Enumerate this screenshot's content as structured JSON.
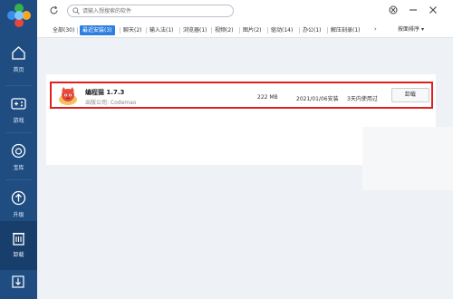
{
  "sidebar": {
    "items": [
      {
        "label": "首页",
        "icon": "home-icon"
      },
      {
        "label": "游戏",
        "icon": "gamepad-icon"
      },
      {
        "label": "宝库",
        "icon": "bag-icon"
      },
      {
        "label": "升级",
        "icon": "upgrade-icon"
      },
      {
        "label": "卸载",
        "icon": "trash-icon"
      }
    ],
    "active_index": 4,
    "bottom_icon": "download-icon"
  },
  "titlebar": {
    "search_placeholder": "请输入想搜索的软件"
  },
  "tabs": [
    {
      "label": "全部(30)"
    },
    {
      "label": "最近安装(3)"
    },
    {
      "label": "聊天(2)"
    },
    {
      "label": "输入法(1)"
    },
    {
      "label": "浏览器(1)"
    },
    {
      "label": "视频(2)"
    },
    {
      "label": "图片(2)"
    },
    {
      "label": "驱动(14)"
    },
    {
      "label": "办公(1)"
    },
    {
      "label": "解压刻录(1)"
    }
  ],
  "active_tab": 1,
  "sort_label": "按面排序",
  "app": {
    "name": "编程猫 1.7.3",
    "publisher": "出版公司: Codemao",
    "size": "222 MB",
    "install_date": "2021/01/06安装",
    "last_used": "3天内使用过",
    "uninstall_label": "卸载"
  },
  "colors": {
    "sidebar": "#1f4d82",
    "accent": "#2f7fe0",
    "highlight_border": "#e0201d"
  }
}
